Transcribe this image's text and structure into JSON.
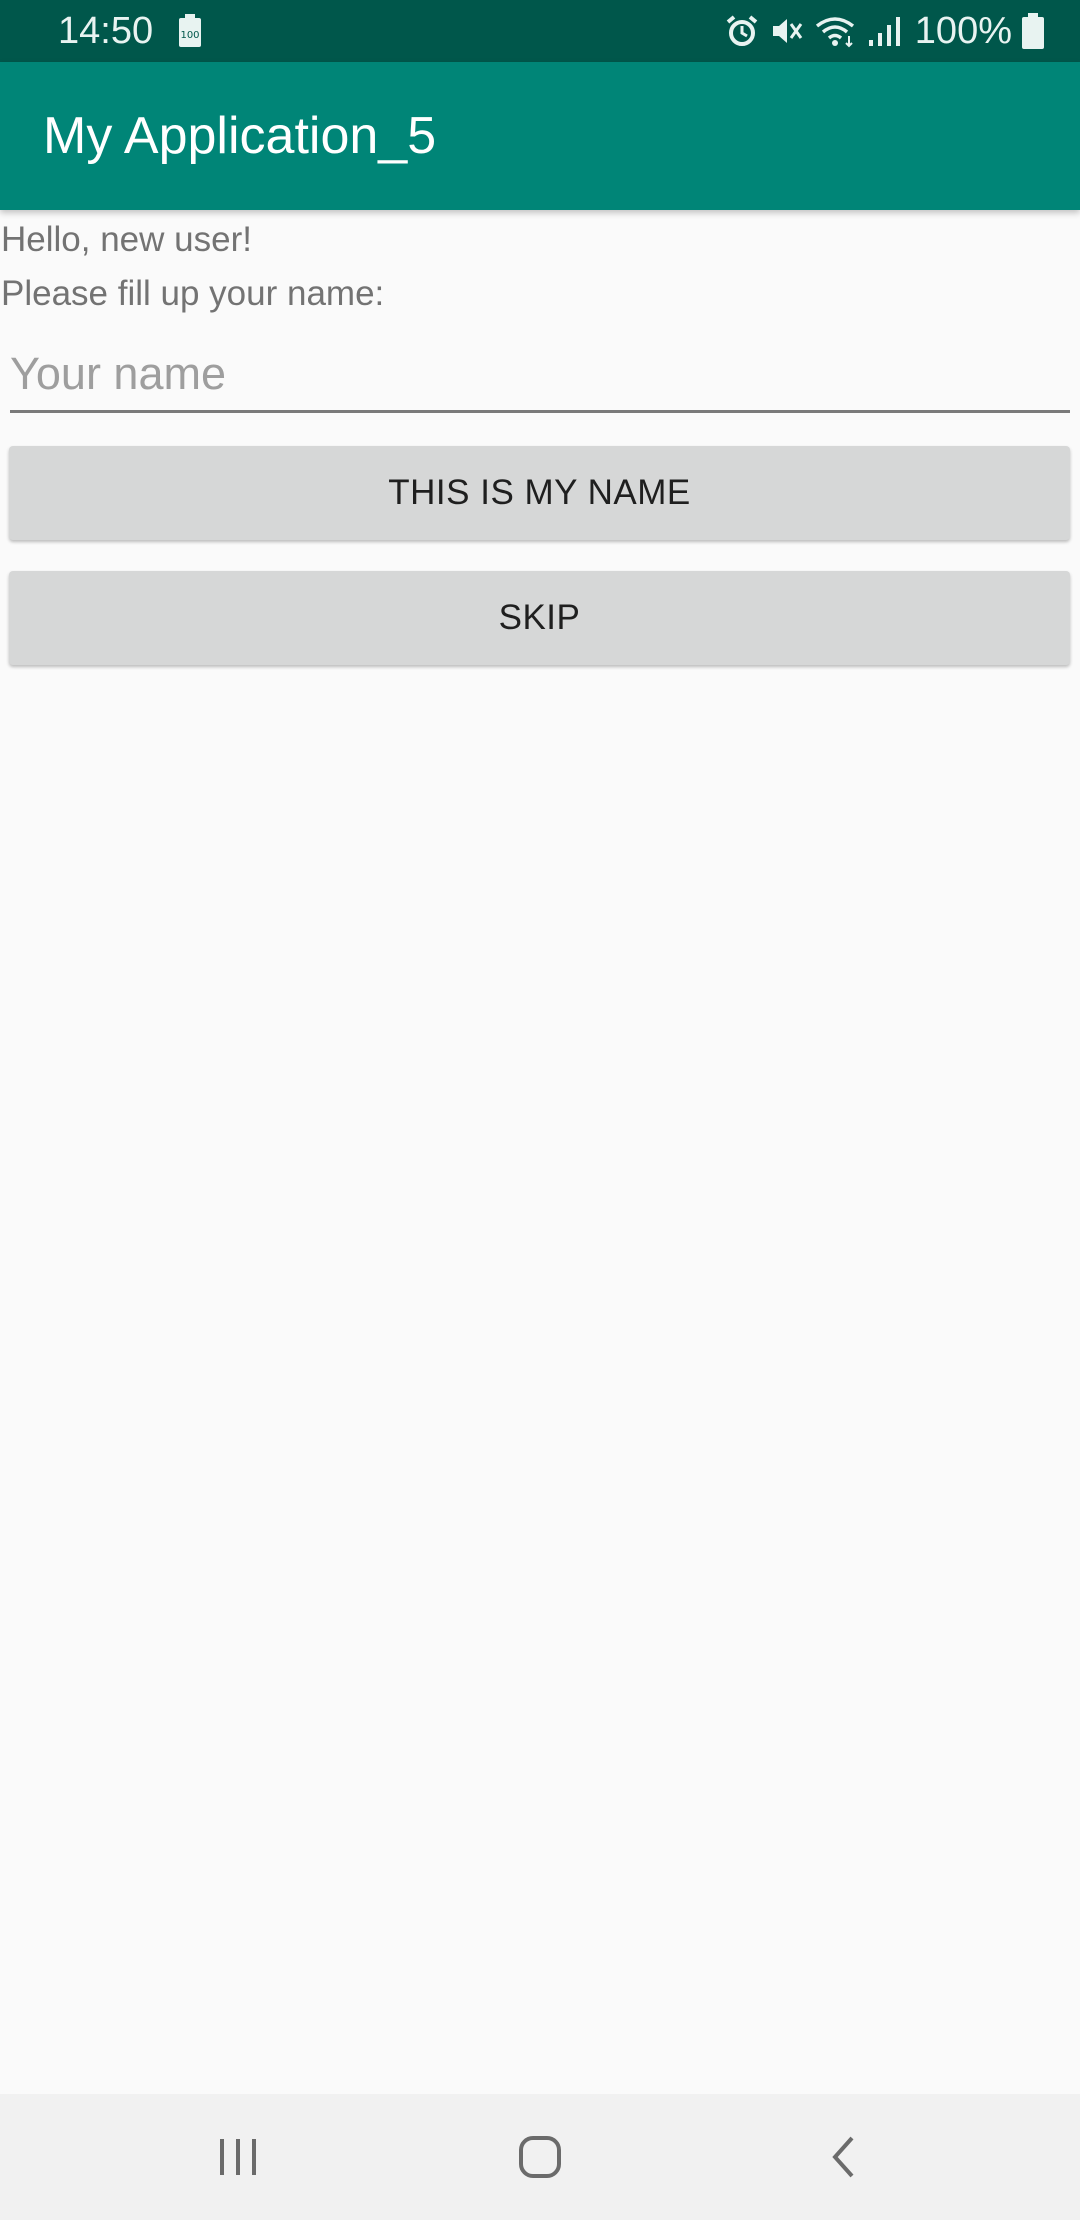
{
  "status_bar": {
    "time": "14:50",
    "battery_percent": "100%",
    "colors": {
      "background": "#00574b",
      "foreground": "#e8f3f1"
    },
    "icons": [
      "battery-saver-icon",
      "alarm-icon",
      "mute-icon",
      "wifi-icon",
      "signal-icon",
      "battery-icon"
    ]
  },
  "app_bar": {
    "title": "My Application_5",
    "color": "#008577"
  },
  "content": {
    "greeting_line1": "Hello, new user!",
    "greeting_line2": "Please fill up your name:",
    "name_input": {
      "placeholder": "Your name",
      "value": ""
    },
    "buttons": {
      "submit_label": "THIS IS MY NAME",
      "skip_label": "SKIP"
    }
  },
  "nav_bar": {
    "icons": [
      "recent-apps-icon",
      "home-icon",
      "back-icon"
    ]
  }
}
